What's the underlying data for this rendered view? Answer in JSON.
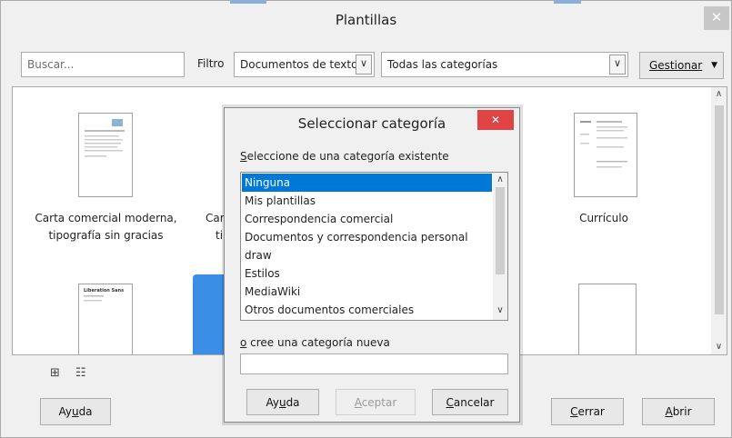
{
  "window": {
    "title": "Plantillas",
    "close_symbol": "✕"
  },
  "toolbar": {
    "search_placeholder": "Buscar...",
    "filter_label": "Filtro",
    "filter_value": "Documentos de texto",
    "category_value": "Todas las categorías",
    "manage_label": "Gestionar",
    "manage_arrow": "▼",
    "dropdown_arrow": "∨"
  },
  "templates": [
    {
      "line1": "Carta comercial moderna,",
      "line2": "tipografía sin gracias"
    },
    {
      "line1": "Car",
      "line2": "ti"
    },
    {
      "line1": "Currículo",
      "line2": ""
    },
    {
      "thumb_text": "Liberation Sans"
    }
  ],
  "scroll": {
    "up": "∧",
    "down": "∨"
  },
  "view_icons": {
    "thumbnail": "⊞",
    "list": "☷"
  },
  "buttons": {
    "help_prefix": "Ay",
    "help_underlined": "u",
    "help_suffix": "da",
    "close_underlined": "C",
    "close_suffix": "errar",
    "open_underlined": "A",
    "open_suffix": "brir"
  },
  "dialog": {
    "title": "Seleccionar categoría",
    "close_symbol": "✕",
    "existing_label_underlined": "S",
    "existing_label_rest": "eleccione de una categoría existente",
    "categories": [
      "Ninguna",
      "Mis plantillas",
      "Correspondencia comercial",
      "Documentos y correspondencia personal",
      "draw",
      "Estilos",
      "MediaWiki",
      "Otros documentos comerciales"
    ],
    "selected_index": 0,
    "new_label_underlined": "o",
    "new_label_rest": " cree una categoría nueva",
    "new_value": "",
    "help_prefix": "Ay",
    "help_underlined": "u",
    "help_suffix": "da",
    "accept_underlined": "A",
    "accept_suffix": "ceptar",
    "cancel_underlined": "C",
    "cancel_suffix": "ancelar"
  }
}
